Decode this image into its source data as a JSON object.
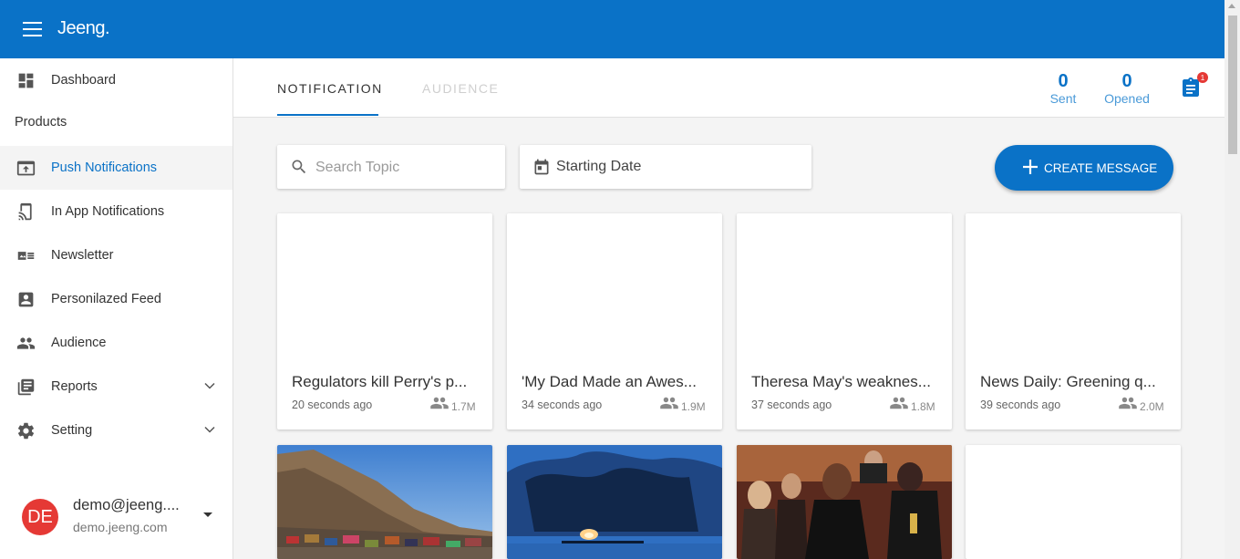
{
  "app": {
    "logo": "Jeeng."
  },
  "sidebar": {
    "items": [
      {
        "label": "Dashboard",
        "icon": "dashboard-icon"
      },
      {
        "label": "Push Notifications",
        "icon": "push-notification-icon",
        "active": true
      },
      {
        "label": "In App Notifications",
        "icon": "cast-icon"
      },
      {
        "label": "Newsletter",
        "icon": "newsletter-icon"
      },
      {
        "label": "Personilazed Feed",
        "icon": "contact-card-icon"
      },
      {
        "label": "Audience",
        "icon": "people-icon"
      },
      {
        "label": "Reports",
        "icon": "reports-icon",
        "expandable": true
      },
      {
        "label": "Setting",
        "icon": "gear-icon",
        "expandable": true
      }
    ],
    "section_label": "Products"
  },
  "user": {
    "initials": "DE",
    "name": "demo@jeeng....",
    "domain": "demo.jeeng.com",
    "avatar_color": "#e53935"
  },
  "tabs": [
    {
      "label": "NOTIFICATION",
      "active": true
    },
    {
      "label": "AUDIENCE",
      "active": false
    }
  ],
  "stats": {
    "sent": {
      "value": "0",
      "label": "Sent"
    },
    "opened": {
      "value": "0",
      "label": "Opened"
    },
    "notification_badge": "1"
  },
  "filters": {
    "search_placeholder": "Search Topic",
    "date_label": "Starting Date"
  },
  "create_button": {
    "label": "CREATE MESSAGE"
  },
  "cards": [
    {
      "title": "Regulators kill Perry's p...",
      "time": "20 seconds ago",
      "audience": "1.7M"
    },
    {
      "title": "'My Dad Made an Awes...",
      "time": "34 seconds ago",
      "audience": "1.9M"
    },
    {
      "title": "Theresa May's weaknes...",
      "time": "37 seconds ago",
      "audience": "1.8M"
    },
    {
      "title": "News Daily: Greening q...",
      "time": "39 seconds ago",
      "audience": "2.0M"
    }
  ],
  "image_cards": [
    {
      "image": "mountain-trucks-photo"
    },
    {
      "image": "burning-ship-photo"
    },
    {
      "image": "red-carpet-photo"
    },
    {
      "image": "blank"
    }
  ],
  "colors": {
    "primary": "#0a72c7",
    "badge": "#e53935",
    "background": "#f4f4f4"
  }
}
